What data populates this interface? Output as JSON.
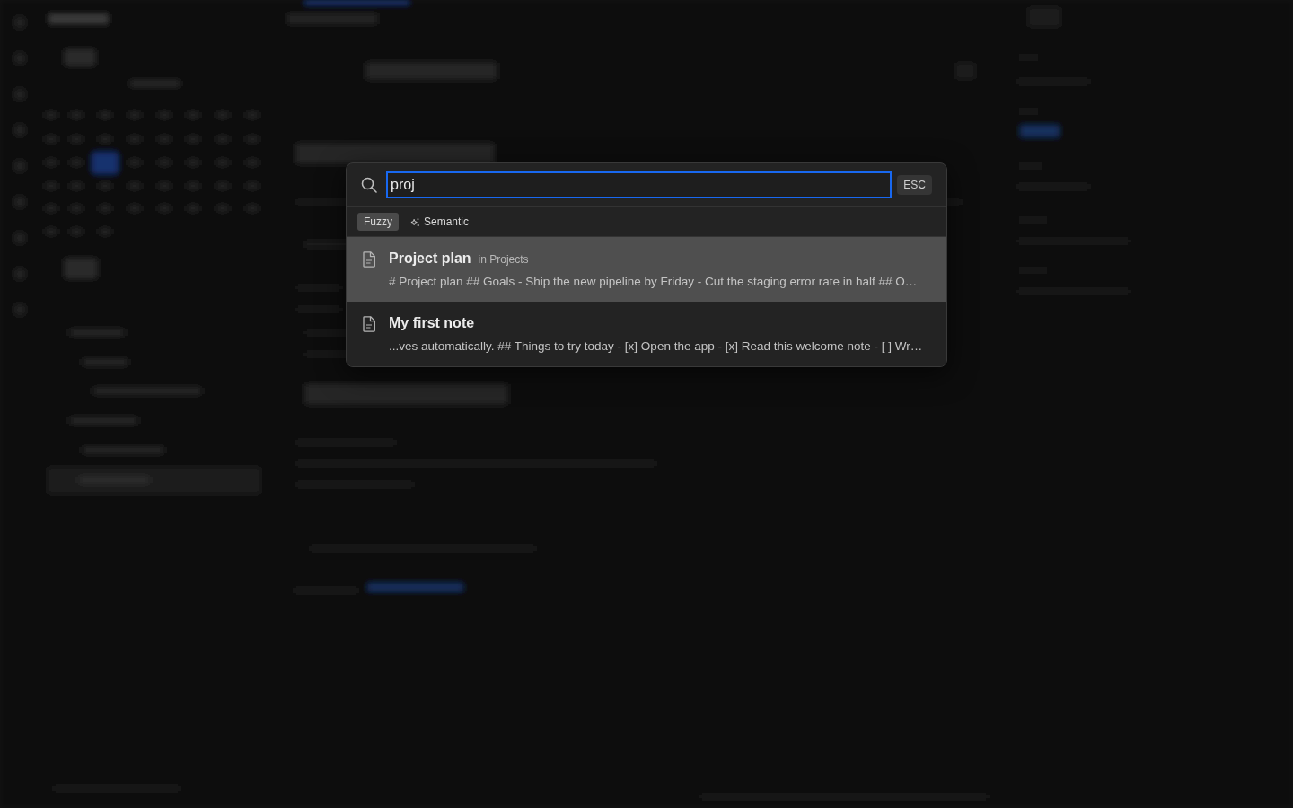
{
  "search": {
    "value": "proj",
    "escape_key": "ESC"
  },
  "modes": [
    {
      "label": "Fuzzy",
      "kind": "plain",
      "selected": true
    },
    {
      "label": "Semantic",
      "kind": "sparkle",
      "selected": false
    }
  ],
  "results": [
    {
      "title": "Project plan",
      "location": "in Projects",
      "snippet": "# Project plan ## Goals - Ship the new pipeline by Friday - Cut the staging error rate in half ## O…",
      "selected": true
    },
    {
      "title": "My first note",
      "snippet": "...ves automatically. ## Things to try today - [x] Open the app - [x] Read this welcome note - [ ] Wr…",
      "selected": false
    }
  ]
}
